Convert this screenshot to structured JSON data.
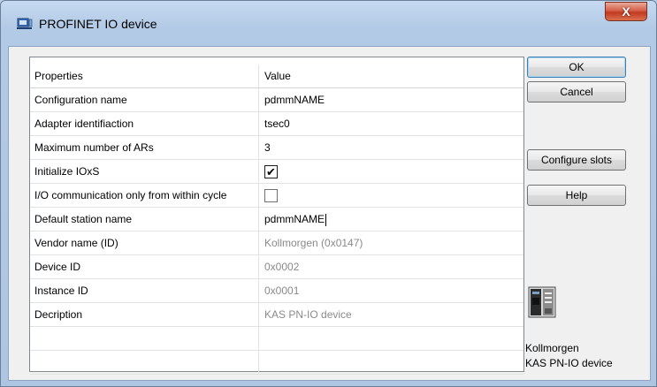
{
  "window": {
    "title": "PROFINET IO device",
    "close_label": "X"
  },
  "grid": {
    "columns": {
      "properties": "Properties",
      "value": "Value"
    },
    "rows": [
      {
        "property": "Configuration name",
        "value": "pdmmNAME",
        "type": "text",
        "readonly": false
      },
      {
        "property": "Adapter identifiaction",
        "value": "tsec0",
        "type": "text",
        "readonly": false
      },
      {
        "property": "Maximum number of ARs",
        "value": "3",
        "type": "text",
        "readonly": false
      },
      {
        "property": "Initialize IOxS",
        "value": "",
        "type": "checkbox",
        "checked": true
      },
      {
        "property": "I/O communication only from within cycle",
        "value": "",
        "type": "checkbox",
        "checked": false
      },
      {
        "property": "Default station name",
        "value": "pdmmNAME",
        "type": "text",
        "readonly": false,
        "editing": true
      },
      {
        "property": "Vendor name (ID)",
        "value": "Kollmorgen (0x0147)",
        "type": "text",
        "readonly": true
      },
      {
        "property": "Device ID",
        "value": "0x0002",
        "type": "text",
        "readonly": true
      },
      {
        "property": "Instance ID",
        "value": "0x0001",
        "type": "text",
        "readonly": true
      },
      {
        "property": "Decription",
        "value": "KAS PN-IO device",
        "type": "text",
        "readonly": true
      }
    ]
  },
  "buttons": {
    "ok": "OK",
    "cancel": "Cancel",
    "configure_slots": "Configure slots",
    "help": "Help"
  },
  "device_info": {
    "vendor": "Kollmorgen",
    "name": "KAS PN-IO device",
    "icon": "device-module-icon"
  },
  "colors": {
    "titlebar": "#b3cae6",
    "close_button": "#c2391f",
    "readonly_text": "#8a8a8a"
  }
}
